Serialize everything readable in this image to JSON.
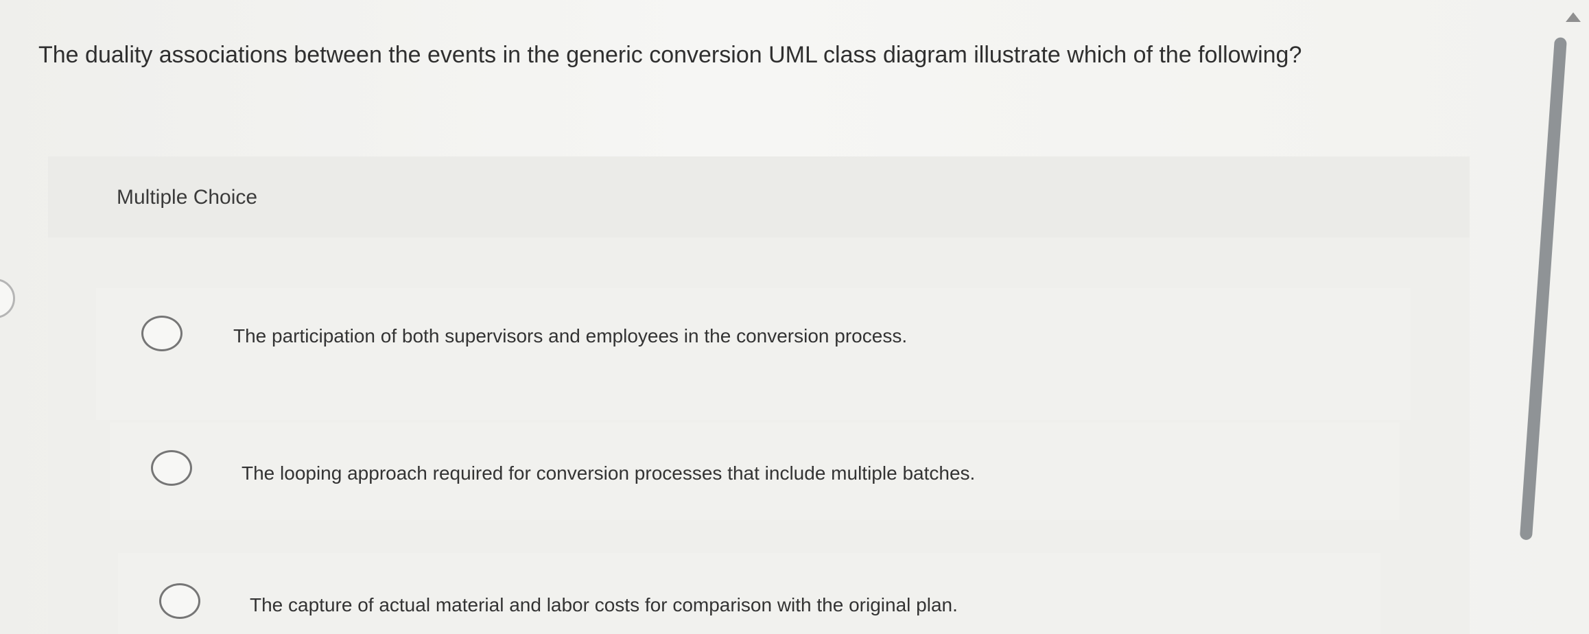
{
  "question": {
    "text": "The duality associations between the events in the generic conversion UML class diagram illustrate which of the following?"
  },
  "panel": {
    "title": "Multiple Choice",
    "options": [
      {
        "label": "The participation of both supervisors and employees in the conversion process.",
        "selected": false
      },
      {
        "label": "The looping approach required for conversion processes that include multiple batches.",
        "selected": false
      },
      {
        "label": "The capture of actual material and labor costs for comparison with the original plan.",
        "selected": false
      }
    ]
  },
  "colors": {
    "background": "#f3f3f1",
    "panel": "#efefec",
    "text": "#333333",
    "radio_border": "#767676",
    "scrollbar": "#8f9396"
  },
  "icons": {
    "scroll_up": "triangle-up-icon",
    "radio": "radio-circle-icon",
    "left_tab": "partial-circle-icon"
  }
}
